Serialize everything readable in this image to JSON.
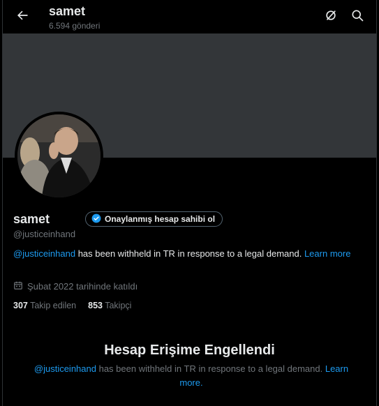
{
  "header": {
    "title": "samet",
    "post_count": "6.594 gönderi"
  },
  "profile": {
    "display_name": "samet",
    "verify_label": "Onaylanmış hesap sahibi ol",
    "handle": "@justiceinhand",
    "withheld_handle": "@justiceinhand",
    "withheld_text": " has been withheld in TR in response to a legal demand. ",
    "learn_more": "Learn more",
    "joined": "Şubat 2022 tarihinde katıldı",
    "following_count": "307",
    "following_label": "Takip edilen",
    "followers_count": "853",
    "followers_label": "Takipçi"
  },
  "blocked": {
    "title": "Hesap Erişime Engellendi",
    "handle": "@justiceinhand",
    "text": " has been withheld in TR in response to a legal demand. ",
    "learn_more": "Learn more."
  },
  "colors": {
    "background": "#000000",
    "banner": "#333639",
    "link": "#1d9bf0",
    "secondary_text": "#71767b",
    "verified_badge": "#1d9bf0"
  },
  "icons": {
    "back": "back-arrow-icon",
    "grok": "grok-icon",
    "search": "search-icon",
    "verified": "verified-badge-icon",
    "calendar": "calendar-icon"
  }
}
